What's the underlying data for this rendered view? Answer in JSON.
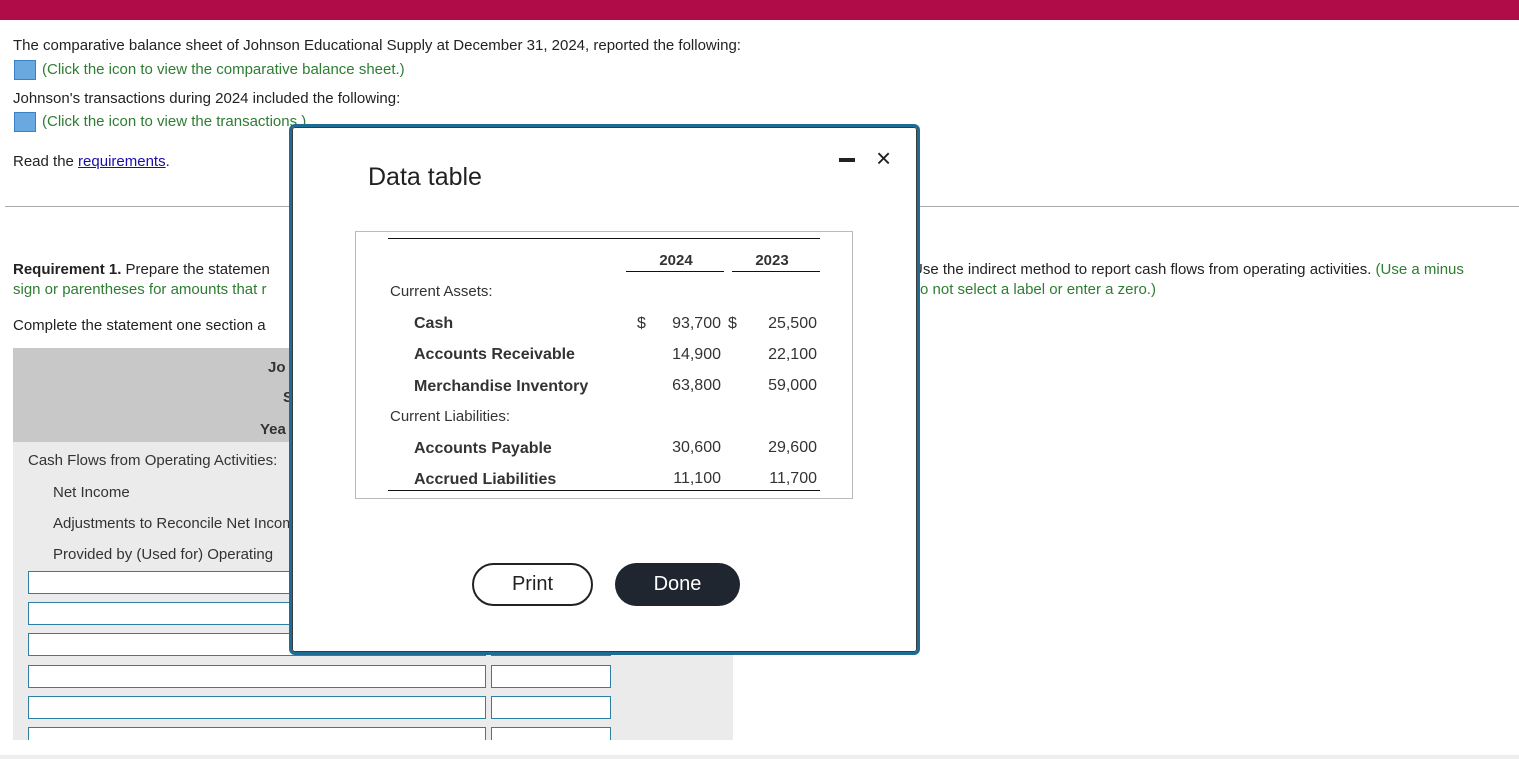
{
  "intro": {
    "line1": "The comparative balance sheet of Johnson Educational Supply at December 31, 2024, reported the following:",
    "link1": "(Click the icon to view the comparative balance sheet.)",
    "line2": "Johnson's transactions during 2024 included the following:",
    "link2": "(Click the icon to view the transactions.)",
    "read_prefix": "Read the ",
    "read_link": "requirements",
    "read_suffix": "."
  },
  "requirement": {
    "label": "Requirement 1.",
    "text_left": " Prepare the statemen",
    "green_left": "sign or parentheses for amounts that r",
    "text_right": "Use the indirect method to report cash flows from operating activities.",
    "green_right1": " (Use a minus",
    "green_right2": "o not select a label or enter a zero.)",
    "complete": "Complete the statement one section a"
  },
  "statement": {
    "header": [
      "Jo",
      "S",
      "Yea"
    ],
    "rows": [
      "Cash Flows from Operating Activities:",
      "Net Income",
      "Adjustments to Reconcile Net Income",
      "Provided by (Used for) Operating"
    ]
  },
  "modal": {
    "title": "Data table",
    "columns": [
      "2024",
      "2023"
    ],
    "sections": [
      {
        "label": "Current Assets:",
        "items": [
          {
            "name": "Cash",
            "y2024": "93,700",
            "y2023": "25,500",
            "dollar": "$"
          },
          {
            "name": "Accounts Receivable",
            "y2024": "14,900",
            "y2023": "22,100"
          },
          {
            "name": "Merchandise Inventory",
            "y2024": "63,800",
            "y2023": "59,000"
          }
        ]
      },
      {
        "label": "Current Liabilities:",
        "items": [
          {
            "name": "Accounts Payable",
            "y2024": "30,600",
            "y2023": "29,600"
          },
          {
            "name": "Accrued Liabilities",
            "y2024": "11,100",
            "y2023": "11,700"
          }
        ]
      }
    ],
    "print_label": "Print",
    "done_label": "Done",
    "close_icon": "×"
  },
  "colors": {
    "brand": "#b00c48",
    "accent_green": "#2e7d32",
    "modal_border": "#1e6b94"
  }
}
